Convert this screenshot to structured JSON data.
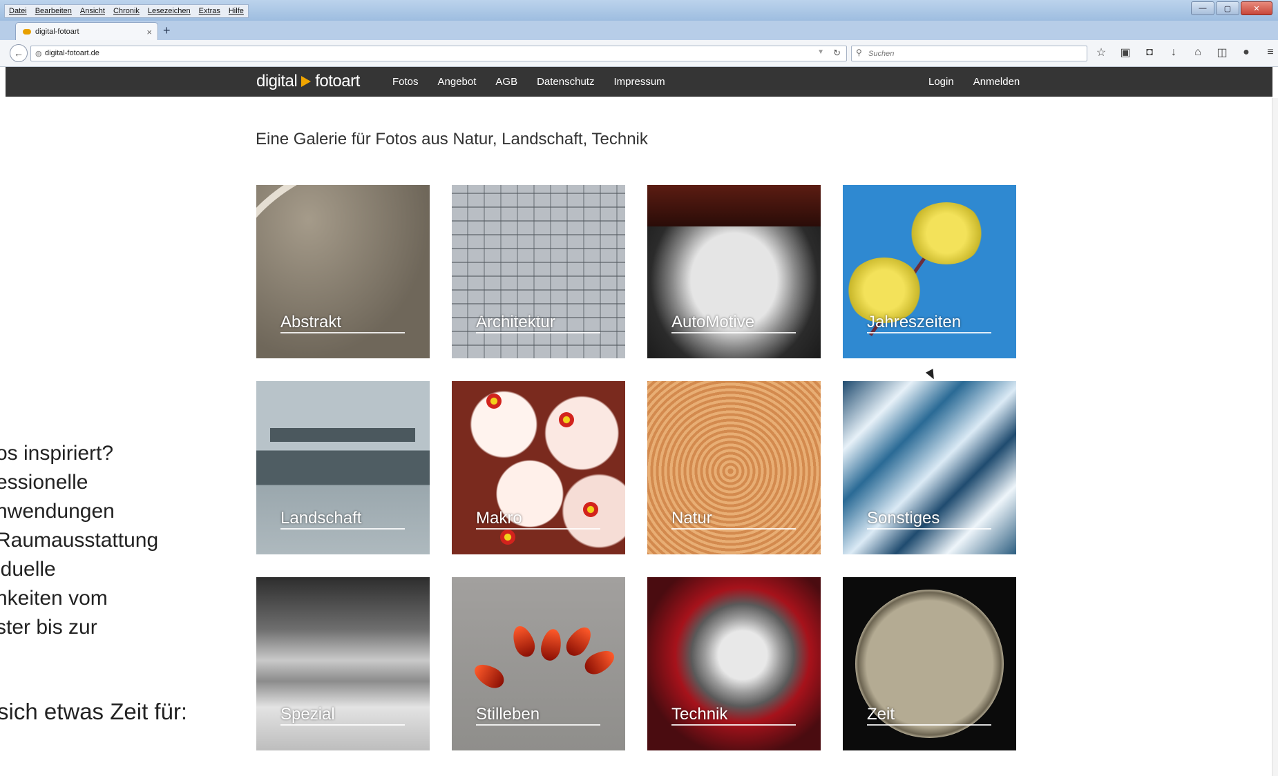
{
  "browser": {
    "menu": [
      "Datei",
      "Bearbeiten",
      "Ansicht",
      "Chronik",
      "Lesezeichen",
      "Extras",
      "Hilfe"
    ],
    "tab_title": "digital-fotoart",
    "tab_close": "×",
    "new_tab": "+",
    "url": "digital-fotoart.de",
    "search_placeholder": "Suchen",
    "toolbar_icons": [
      "star-icon",
      "clipboard-icon",
      "pocket-icon",
      "download-icon",
      "home-icon",
      "sidebar-icon",
      "chat-icon",
      "menu-icon"
    ]
  },
  "site": {
    "logo": {
      "left": "digital",
      "right": "fotoart",
      "arrow_color": "#f0a500"
    },
    "nav": [
      "Fotos",
      "Angebot",
      "AGB",
      "Datenschutz",
      "Impressum"
    ],
    "nav_right": [
      "Login",
      "Anmelden"
    ],
    "tagline": "Eine Galerie für Fotos aus Natur, Landschaft, Technik",
    "categories": [
      "Abstrakt",
      "Architektur",
      "AutoMotive",
      "Jahreszeiten",
      "Landschaft",
      "Makro",
      "Natur",
      "Sonstiges",
      "Spezial",
      "Stilleben",
      "Technik",
      "Zeit"
    ],
    "sidebar_lines": [
      "os inspiriert?",
      "essionelle",
      "nwendungen",
      "Raumausstattung",
      "iduelle",
      "hkeiten vom",
      "ster bis zur"
    ],
    "sidebar_footer": "sich etwas Zeit für:",
    "bar_color": "#353535"
  }
}
